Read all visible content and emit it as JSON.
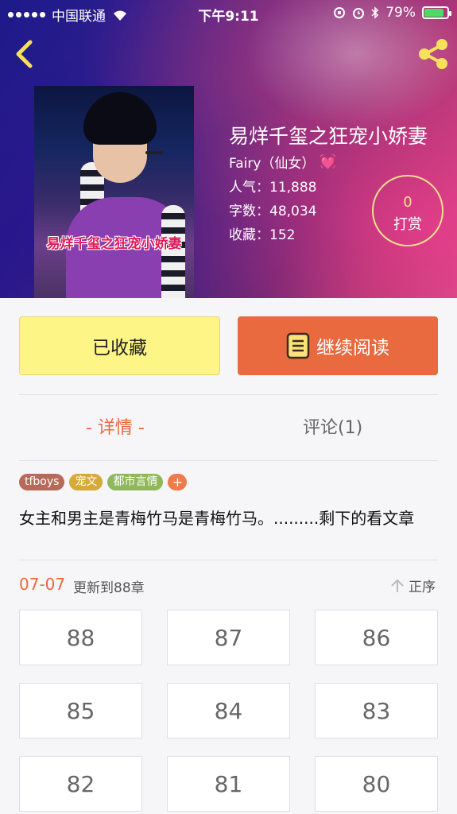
{
  "status_bar": {
    "carrier": "中国联通",
    "time": "下午9:11",
    "battery": "79%",
    "battery_level": 0.79
  },
  "book": {
    "title": "易烊千玺之狂宠小娇妻",
    "author": "Fairy（仙女）",
    "cover_title": "易烊千玺之狂宠小娇妻",
    "popularity": "人气：11,888",
    "word_count": "字数：48,034",
    "favorites": "收藏：152",
    "reward_count": "0",
    "reward_label": "打赏"
  },
  "actions": {
    "favorite_label": "已收藏",
    "read_label": "继续阅读"
  },
  "tabs": {
    "detail": "- 详情 -",
    "comments": "评论(1)"
  },
  "tags": [
    "tfboys",
    "宠文",
    "都市言情"
  ],
  "tag_add": "+",
  "summary": "女主和男主是青梅竹马是青梅竹马。.........剩下的看文章",
  "update": {
    "date": "07-07",
    "text": "更新到88章",
    "sort_label": "正序"
  },
  "chapters": [
    "88",
    "87",
    "86",
    "85",
    "84",
    "83",
    "82",
    "81",
    "80"
  ],
  "colors": {
    "accent": "#e96a3e",
    "favorite_button": "#fdf585",
    "reward_ring": "#f5e08c"
  },
  "icons": {
    "back": "chevron-left-icon",
    "share": "share-icon",
    "read": "book-icon",
    "sort": "arrow-up-icon"
  }
}
